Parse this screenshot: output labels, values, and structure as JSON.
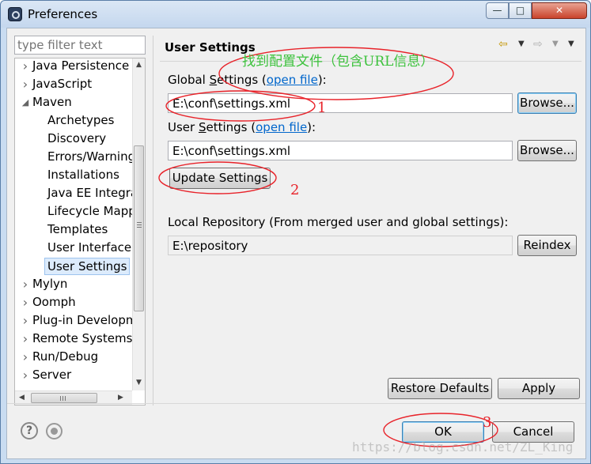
{
  "window": {
    "title": "Preferences",
    "icons": {
      "app": "eclipse-icon",
      "minimize": "minimize-icon",
      "maximize": "maximize-icon",
      "close": "close-icon"
    }
  },
  "sidebar": {
    "filter_placeholder": "type filter text",
    "items": [
      {
        "label": "Java Persistence",
        "level": 0,
        "expander": "collapsed"
      },
      {
        "label": "JavaScript",
        "level": 0,
        "expander": "collapsed"
      },
      {
        "label": "Maven",
        "level": 0,
        "expander": "expanded"
      },
      {
        "label": "Archetypes",
        "level": 1,
        "expander": "none"
      },
      {
        "label": "Discovery",
        "level": 1,
        "expander": "none"
      },
      {
        "label": "Errors/Warnings",
        "level": 1,
        "expander": "none"
      },
      {
        "label": "Installations",
        "level": 1,
        "expander": "none"
      },
      {
        "label": "Java EE Integration",
        "level": 1,
        "expander": "none"
      },
      {
        "label": "Lifecycle Mappings",
        "level": 1,
        "expander": "none"
      },
      {
        "label": "Templates",
        "level": 1,
        "expander": "none"
      },
      {
        "label": "User Interface",
        "level": 1,
        "expander": "none"
      },
      {
        "label": "User Settings",
        "level": 1,
        "expander": "none",
        "selected": true
      },
      {
        "label": "Mylyn",
        "level": 0,
        "expander": "collapsed"
      },
      {
        "label": "Oomph",
        "level": 0,
        "expander": "collapsed"
      },
      {
        "label": "Plug-in Development",
        "level": 0,
        "expander": "collapsed"
      },
      {
        "label": "Remote Systems",
        "level": 0,
        "expander": "collapsed"
      },
      {
        "label": "Run/Debug",
        "level": 0,
        "expander": "collapsed"
      },
      {
        "label": "Server",
        "level": 0,
        "expander": "collapsed"
      }
    ]
  },
  "page": {
    "title": "User Settings",
    "nav_icons": {
      "back": "back-arrow-icon",
      "forward": "forward-arrow-icon",
      "menu": "view-menu-icon"
    },
    "global": {
      "label_before": "Global ",
      "label_mnemonic": "S",
      "label_after": "ettings (",
      "link": "open file",
      "label_end": "):",
      "value": "E:\\conf\\settings.xml",
      "browse_label": "Browse..."
    },
    "user": {
      "label_before": "User ",
      "label_mnemonic": "S",
      "label_after": "ettings (",
      "link": "open file",
      "label_end": "):",
      "value": "E:\\conf\\settings.xml",
      "browse_label": "Browse..."
    },
    "update_label": "Update Settings",
    "local_repo": {
      "label": "Local Repository (From merged user and global settings):",
      "value": "E:\\repository",
      "reindex_label": "Reindex"
    },
    "restore_defaults_label": "Restore Defaults",
    "apply_label": "Apply"
  },
  "footer": {
    "help_icon": "help-icon",
    "oomph_icon": "oomph-record-icon",
    "ok_label": "OK",
    "cancel_label": "Cancel"
  },
  "annotations": {
    "color": "#e8232a",
    "note_color": "#3cc23c",
    "note": "找到配置文件（包含URL信息）",
    "markers": [
      "1",
      "2",
      "3"
    ]
  },
  "watermark": "https://blog.csdn.net/ZL_King"
}
